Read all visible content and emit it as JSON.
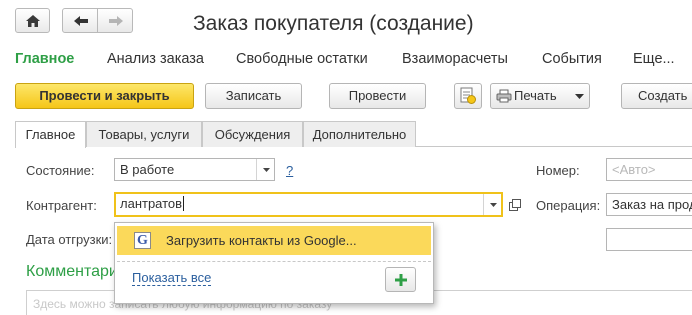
{
  "window": {
    "title": "Заказ покупателя (создание)"
  },
  "nav": {
    "home_icon": "home-icon",
    "back_icon": "arrow-left-icon",
    "forward_icon": "arrow-right-icon"
  },
  "sections": [
    "Главное",
    "Анализ заказа",
    "Свободные остатки",
    "Взаиморасчеты",
    "События",
    "Еще..."
  ],
  "toolbar": {
    "post_close": "Провести и закрыть",
    "save": "Записать",
    "post": "Провести",
    "print": "Печать",
    "create": "Создать"
  },
  "tabs": [
    "Главное",
    "Товары, услуги",
    "Обсуждения",
    "Дополнительно"
  ],
  "form": {
    "state_label": "Состояние:",
    "state_value": "В работе",
    "help": "?",
    "counterparty_label": "Контрагент:",
    "counterparty_value": "лантратов",
    "ship_date_label": "Дата отгрузки:",
    "number_label": "Номер:",
    "number_placeholder": "<Авто>",
    "operation_label": "Операция:",
    "operation_value": "Заказ на продажу"
  },
  "dropdown": {
    "google_item": "Загрузить контакты из Google...",
    "show_all": "Показать все"
  },
  "comment": {
    "title": "Комментарий",
    "placeholder": "Здесь можно записать любую информацию по заказу"
  },
  "colors": {
    "accent_green": "#2e9f46",
    "primary_yellow": "#f5c618",
    "highlight": "#fbd95a",
    "link": "#2b5f9e"
  }
}
